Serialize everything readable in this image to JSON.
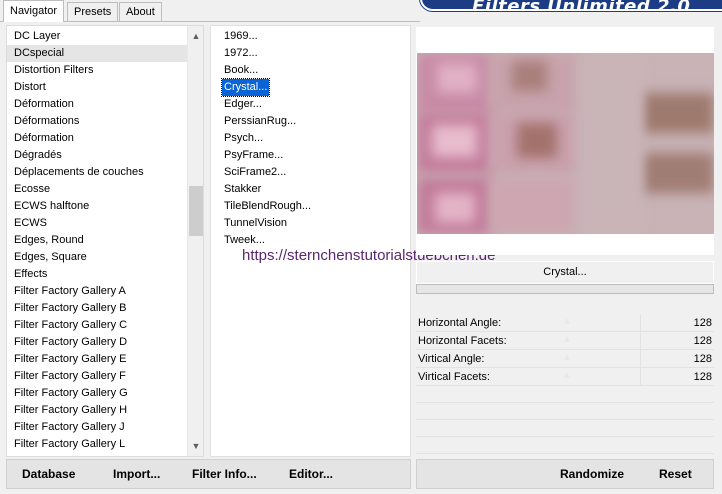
{
  "tabs": [
    {
      "label": "Navigator"
    },
    {
      "label": "Presets"
    },
    {
      "label": "About"
    }
  ],
  "banner": {
    "title": "Filters Unlimited 2.0"
  },
  "categories": [
    "DC Layer",
    "DCspecial",
    "Distortion Filters",
    "Distort",
    "Déformation",
    "Déformations",
    "Déformation",
    "Dégradés",
    "Déplacements de couches",
    "Ecosse",
    "ECWS halftone",
    "ECWS",
    "Edges, Round",
    "Edges, Square",
    "Effects",
    "Filter Factory Gallery A",
    "Filter Factory Gallery B",
    "Filter Factory Gallery C",
    "Filter Factory Gallery D",
    "Filter Factory Gallery E",
    "Filter Factory Gallery F",
    "Filter Factory Gallery G",
    "Filter Factory Gallery H",
    "Filter Factory Gallery J",
    "Filter Factory Gallery L"
  ],
  "selected_category": "DCspecial",
  "effects": [
    "1969...",
    "1972...",
    "Book...",
    "Crystal...",
    "Edger...",
    "PerssianRug...",
    "Psych...",
    "PsyFrame...",
    "SciFrame2...",
    "Stakker",
    "TileBlendRough...",
    "TunnelVision",
    "Tweek..."
  ],
  "selected_effect": "Crystal...",
  "watermark": "https://sternchenstutorialstuebchen.de",
  "filter_button_label": "Crystal...",
  "params": [
    {
      "label": "Horizontal Angle:",
      "value": "128"
    },
    {
      "label": "Horizontal Facets:",
      "value": "128"
    },
    {
      "label": "Virtical Angle:",
      "value": "128"
    },
    {
      "label": "Virtical Facets:",
      "value": "128"
    }
  ],
  "buttons": {
    "database": "Database",
    "import": "Import...",
    "filter_info": "Filter Info...",
    "editor": "Editor...",
    "randomize": "Randomize",
    "reset": "Reset"
  },
  "icons": {
    "scroll_up": "chevron-up-icon",
    "scroll_down": "chevron-down-icon"
  }
}
